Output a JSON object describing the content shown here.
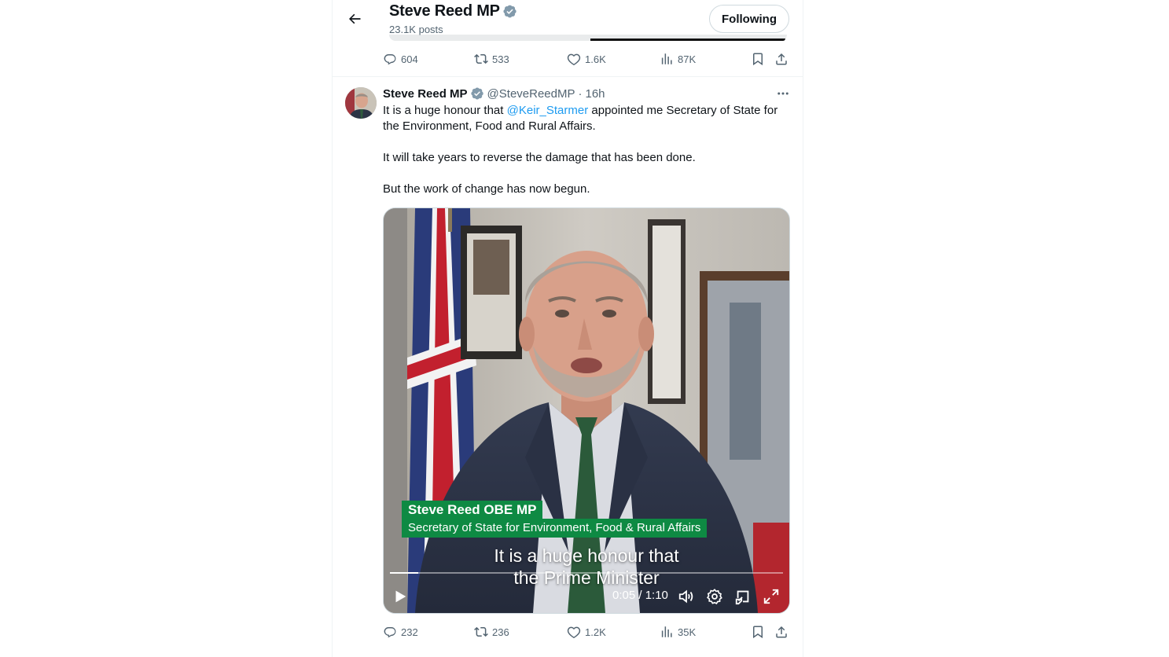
{
  "header": {
    "title": "Steve Reed MP",
    "posts": "23.1K posts",
    "follow_label": "Following"
  },
  "prev_tweet_actions": {
    "replies": "604",
    "reposts": "533",
    "likes": "1.6K",
    "views": "87K"
  },
  "tweet": {
    "author_name": "Steve Reed MP",
    "handle": "@SteveReedMP",
    "separator": "·",
    "time": "16h",
    "text_before_mention": "It is a huge honour that ",
    "mention": "@Keir_Starmer",
    "text_after_mention": " appointed me Secretary of State for the Environment, Food and Rural Affairs.",
    "paragraph_2": "It will take years to reverse the damage that has been done.",
    "paragraph_3": "But the work of change has now begun.",
    "video": {
      "lower_third_name": "Steve Reed OBE MP",
      "lower_third_role": "Secretary of State for Environment, Food & Rural Affairs",
      "caption_line_1": "It is a huge honour that",
      "caption_line_2": "the Prime Minister",
      "time_display": "0:05 / 1:10",
      "progress_fraction": 0.071
    },
    "actions": {
      "replies": "232",
      "reposts": "236",
      "likes": "1.2K",
      "views": "35K"
    }
  },
  "colors": {
    "accent": "#1d9bf0",
    "verified_badge": "#829aab",
    "muted_text": "#536471",
    "lower_third_green": "#0e8a43"
  },
  "icons": [
    "back-arrow-icon",
    "verified-badge-icon",
    "reply-icon",
    "repost-icon",
    "like-icon",
    "views-icon",
    "bookmark-icon",
    "share-icon",
    "more-icon",
    "play-icon",
    "volume-icon",
    "settings-icon",
    "pip-icon",
    "fullscreen-icon"
  ]
}
